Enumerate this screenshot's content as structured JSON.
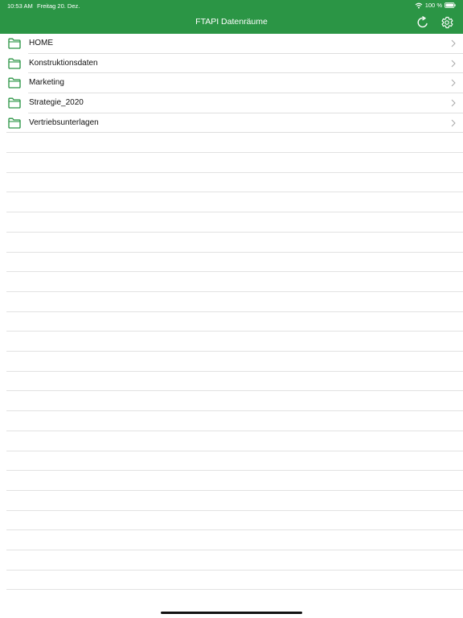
{
  "status_bar": {
    "time": "10:53 AM",
    "date": "Freitag 20. Dez.",
    "battery": "100 %"
  },
  "nav": {
    "title": "FTAPI Datenräume",
    "refresh_icon": "refresh-icon",
    "settings_icon": "gear-icon"
  },
  "colors": {
    "header": "#2b9545",
    "folder": "#2b9545"
  },
  "folders": [
    {
      "label": "HOME",
      "icon": "folder-icon"
    },
    {
      "label": "Konstruktionsdaten",
      "icon": "folder-icon"
    },
    {
      "label": "Marketing",
      "icon": "folder-icon"
    },
    {
      "label": "Strategie_2020",
      "icon": "folder-icon"
    },
    {
      "label": "Vertriebsunterlagen",
      "icon": "folder-icon"
    }
  ]
}
